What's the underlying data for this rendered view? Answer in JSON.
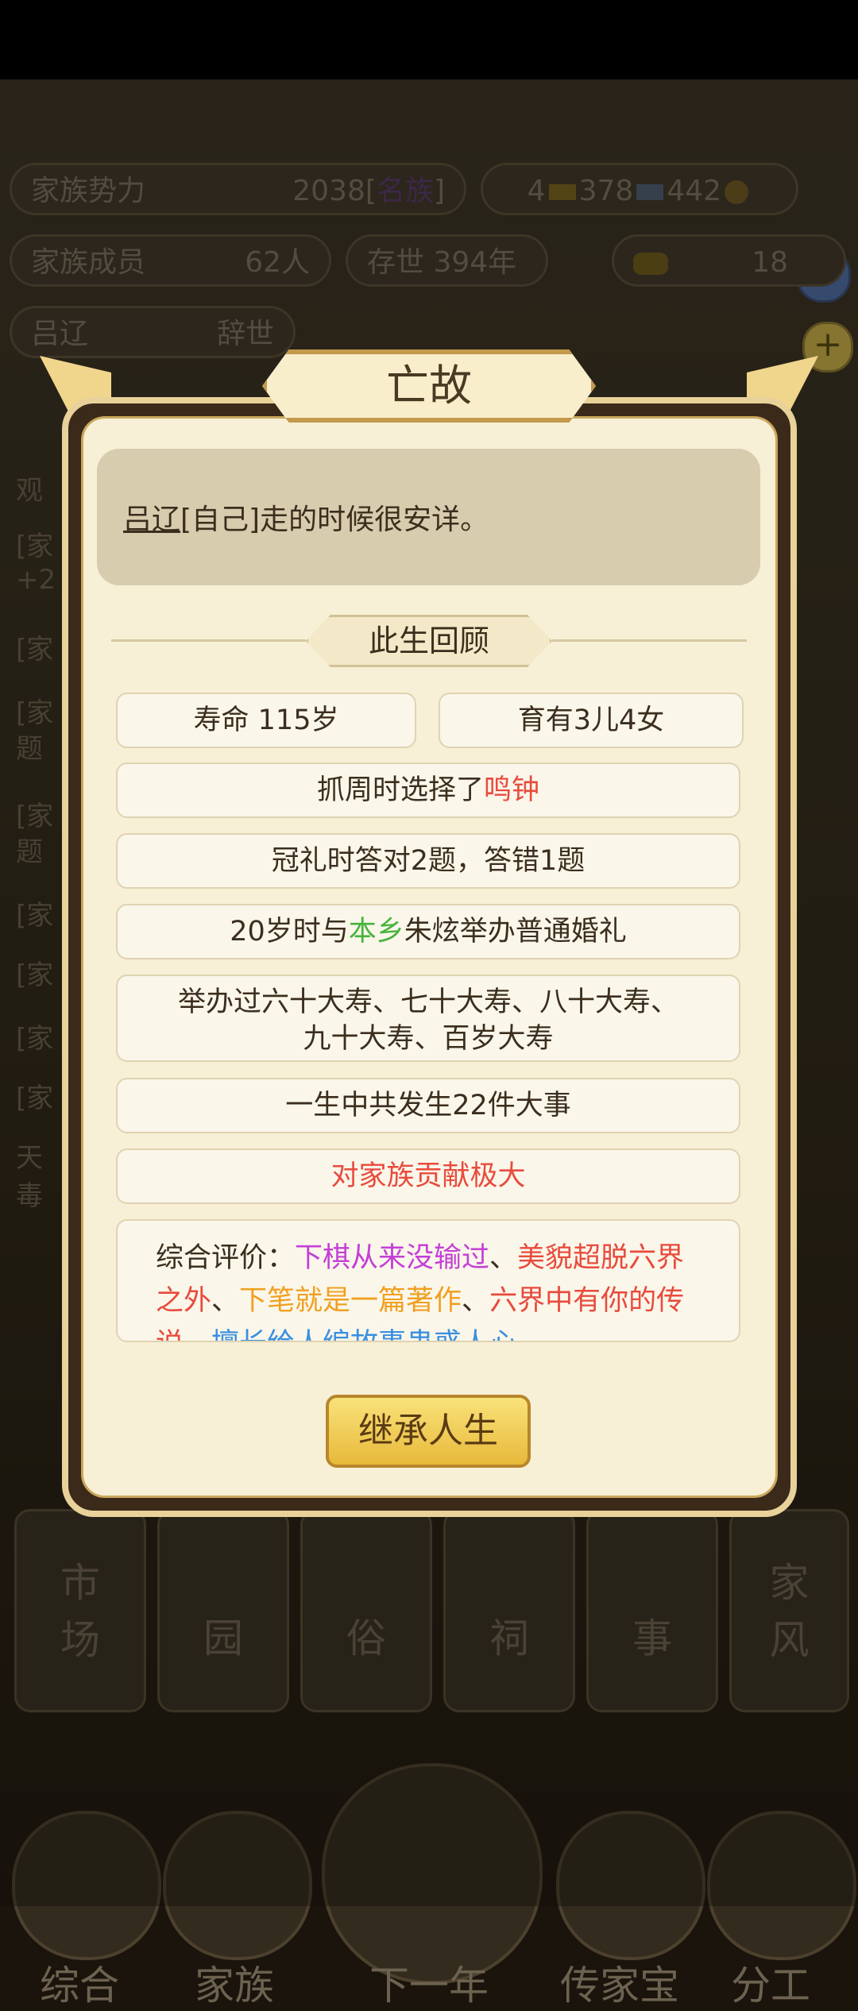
{
  "header": {
    "family_power_label": "家族势力",
    "family_power_value": "2038",
    "family_power_rank": "名族",
    "gold_count": "4",
    "silver_count": "378",
    "coin_count": "442",
    "members_label": "家族成员",
    "members_value": "62人",
    "existence_label": "存世",
    "existence_value": "394年",
    "ingot_count": "18",
    "person_name": "吕辽",
    "person_status": "辞世"
  },
  "background_log": [
    "观",
    "[家",
    "+2",
    "[家",
    "[家",
    "题",
    "[家",
    "题",
    "[家",
    "[家",
    "[家",
    "[家",
    "天",
    "毒"
  ],
  "bottom_tiles": [
    "市场",
    "园",
    "俗",
    "祠",
    "事",
    "家风"
  ],
  "bottom_nav": [
    "综合",
    "家族",
    "下一年",
    "传家宝",
    "分工"
  ],
  "dialog": {
    "title": "亡故",
    "message_name": "吕辽",
    "message_rest": "[自己]走的时候很安详。",
    "section_title": "此生回顾",
    "lifespan": "寿命 115岁",
    "children": "育有3儿4女",
    "zhuazhou_prefix": "抓周时选择了",
    "zhuazhou_item": "鸣钟",
    "capping": "冠礼时答对2题，答错1题",
    "marriage_prefix": "20岁时与",
    "marriage_place": "本乡",
    "marriage_suffix": "朱炫举办普通婚礼",
    "birthdays_line1": "举办过六十大寿、七十大寿、八十大寿、",
    "birthdays_line2": "九十大寿、百岁大寿",
    "events": "一生中共发生22件大事",
    "contribution": "对家族贡献极大",
    "eval_label": "综合评价：",
    "eval_1": "下棋从来没输过",
    "eval_sep": "、",
    "eval_2": "美貌超脱六界之外",
    "eval_3": "下笔就是一篇著作",
    "eval_4": "六界中有你的传说",
    "eval_5": "擅长给人编故事蛊惑人心",
    "inherit_button": "继承人生"
  },
  "colors": {
    "accent_gold": "#e8b93a",
    "red_text": "#e84b3c",
    "green_text": "#46b43c",
    "purple_text": "#c43fd6",
    "orange_text": "#f0a020",
    "blue_text": "#3a8fe0"
  }
}
